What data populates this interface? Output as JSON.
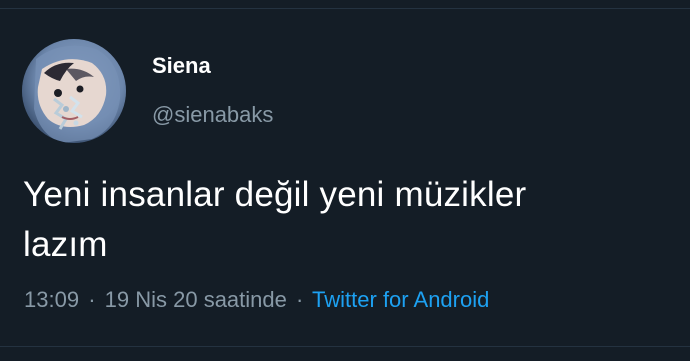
{
  "tweet": {
    "author": {
      "display_name": "Siena",
      "handle": "@sienabaks"
    },
    "text_line1": "Yeni insanlar değil yeni müzikler",
    "text_line2": "lazım",
    "meta": {
      "time": "13:09",
      "separator1": "·",
      "date": "19 Nis 20 saatinde",
      "separator2": "·",
      "source": "Twitter for Android"
    }
  },
  "colors": {
    "background": "#141d26",
    "primary_text": "#ffffff",
    "secondary_text": "#8899a6",
    "link": "#1da1f2"
  },
  "icons": {
    "avatar": "profile-photo"
  }
}
